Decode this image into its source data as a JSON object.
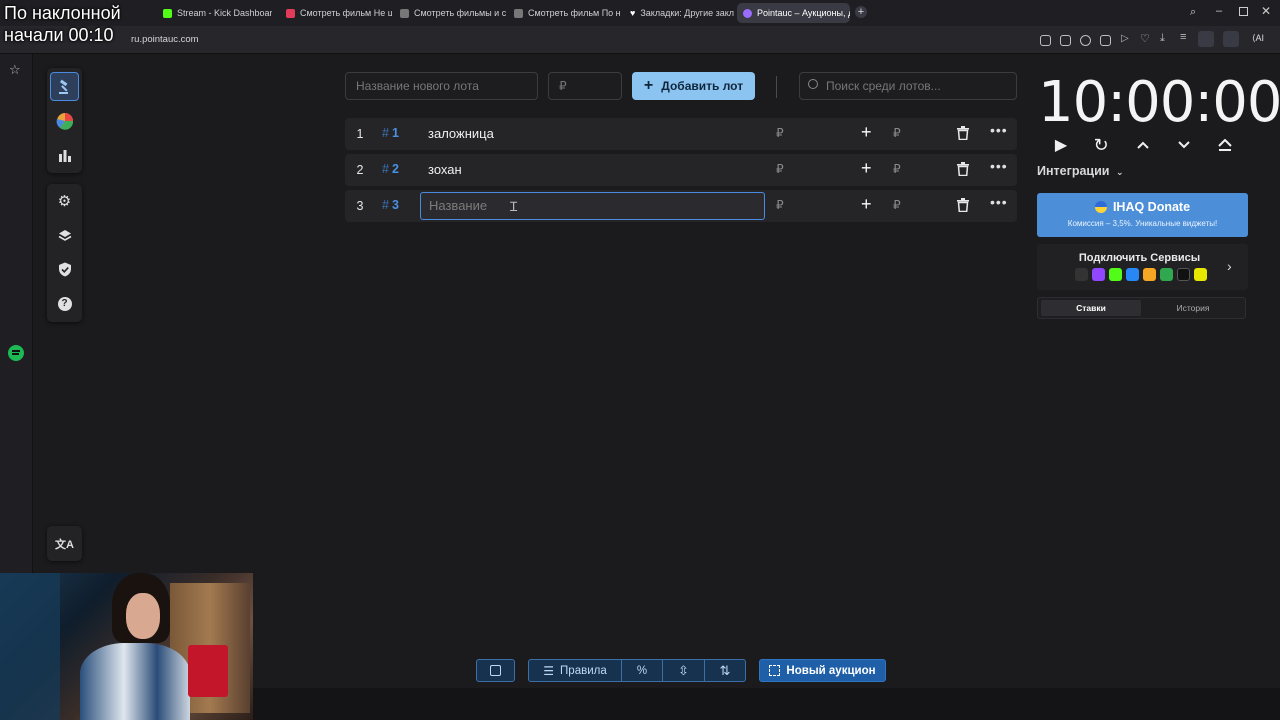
{
  "tabs": [
    {
      "label": "Stream - Kick Dashboard",
      "fav": "#53fc18"
    },
    {
      "label": "Смотреть фильм Не шути",
      "fav": "#e23b5a"
    },
    {
      "label": "Смотреть фильмы и сери",
      "fav": "#888"
    },
    {
      "label": "Смотреть фильм По накл",
      "fav": "#888"
    },
    {
      "label": "Закладки: Другие заклад",
      "fav": "#fff"
    },
    {
      "label": "Pointauc – Аукционы, до",
      "fav": "#9a6cff"
    }
  ],
  "browser": {
    "url": "ru.pointauc.com"
  },
  "overlay": {
    "line1": "По наклонной",
    "line2": "начали 00:10"
  },
  "form": {
    "lot_name_placeholder": "Название нового лота",
    "amount_placeholder": "₽",
    "add_label": "Добавить лот",
    "search_placeholder": "Поиск среди лотов..."
  },
  "lots": [
    {
      "index": "1",
      "id": "1",
      "name": "заложница",
      "currency": "₽"
    },
    {
      "index": "2",
      "id": "2",
      "name": "зохан",
      "currency": "₽"
    },
    {
      "index": "3",
      "id": "3",
      "name_placeholder": "Название",
      "currency": "₽"
    }
  ],
  "timer": {
    "value": "10:00:00"
  },
  "integrations": {
    "title": "Интеграции",
    "donate_title": "IHAQ Donate",
    "donate_sub": "Комиссия – 3,5%. Уникальные виджеты!",
    "connect_title": "Подключить Сервисы",
    "tab_bids": "Ставки",
    "tab_history": "История"
  },
  "bottom": {
    "rules_label": "Правила",
    "percent_label": "%",
    "new_auction_label": "Новый аукцион"
  },
  "colors": {
    "accent": "#8cc4f1",
    "active_border": "#4a8be0",
    "donate": "#4c8fd8"
  }
}
